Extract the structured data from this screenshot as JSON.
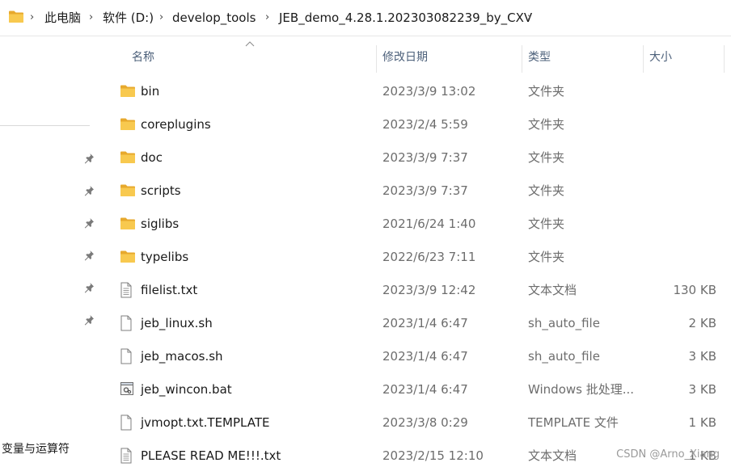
{
  "breadcrumb": {
    "items": [
      "此电脑",
      "软件 (D:)",
      "develop_tools",
      "JEB_demo_4.28.1.202303082239_by_CXV"
    ],
    "separator": ">"
  },
  "nav": {
    "bottom_label": "变量与运算符"
  },
  "columns": {
    "name": "名称",
    "date": "修改日期",
    "type": "类型",
    "size": "大小"
  },
  "files": [
    {
      "name": "bin",
      "date": "2023/3/9 13:02",
      "type": "文件夹",
      "size": "",
      "icon": "folder-icon"
    },
    {
      "name": "coreplugins",
      "date": "2023/2/4 5:59",
      "type": "文件夹",
      "size": "",
      "icon": "folder-icon"
    },
    {
      "name": "doc",
      "date": "2023/3/9 7:37",
      "type": "文件夹",
      "size": "",
      "icon": "folder-icon"
    },
    {
      "name": "scripts",
      "date": "2023/3/9 7:37",
      "type": "文件夹",
      "size": "",
      "icon": "folder-icon"
    },
    {
      "name": "siglibs",
      "date": "2021/6/24 1:40",
      "type": "文件夹",
      "size": "",
      "icon": "folder-icon"
    },
    {
      "name": "typelibs",
      "date": "2022/6/23 7:11",
      "type": "文件夹",
      "size": "",
      "icon": "folder-icon"
    },
    {
      "name": "filelist.txt",
      "date": "2023/3/9 12:42",
      "type": "文本文档",
      "size": "130 KB",
      "icon": "text-file-icon"
    },
    {
      "name": "jeb_linux.sh",
      "date": "2023/1/4 6:47",
      "type": "sh_auto_file",
      "size": "2 KB",
      "icon": "blank-file-icon"
    },
    {
      "name": "jeb_macos.sh",
      "date": "2023/1/4 6:47",
      "type": "sh_auto_file",
      "size": "3 KB",
      "icon": "blank-file-icon"
    },
    {
      "name": "jeb_wincon.bat",
      "date": "2023/1/4 6:47",
      "type": "Windows 批处理...",
      "size": "3 KB",
      "icon": "batch-file-icon"
    },
    {
      "name": "jvmopt.txt.TEMPLATE",
      "date": "2023/3/8 0:29",
      "type": "TEMPLATE 文件",
      "size": "1 KB",
      "icon": "blank-file-icon"
    },
    {
      "name": "PLEASE READ ME!!!.txt",
      "date": "2023/2/15 12:10",
      "type": "文本文档",
      "size": "1 KB",
      "icon": "text-file-icon"
    }
  ],
  "watermark": "CSDN @Arno_Xiang",
  "colors": {
    "folder": "#f4c04e",
    "header_text": "#4c607a",
    "secondary_text": "#6d6d6d"
  }
}
